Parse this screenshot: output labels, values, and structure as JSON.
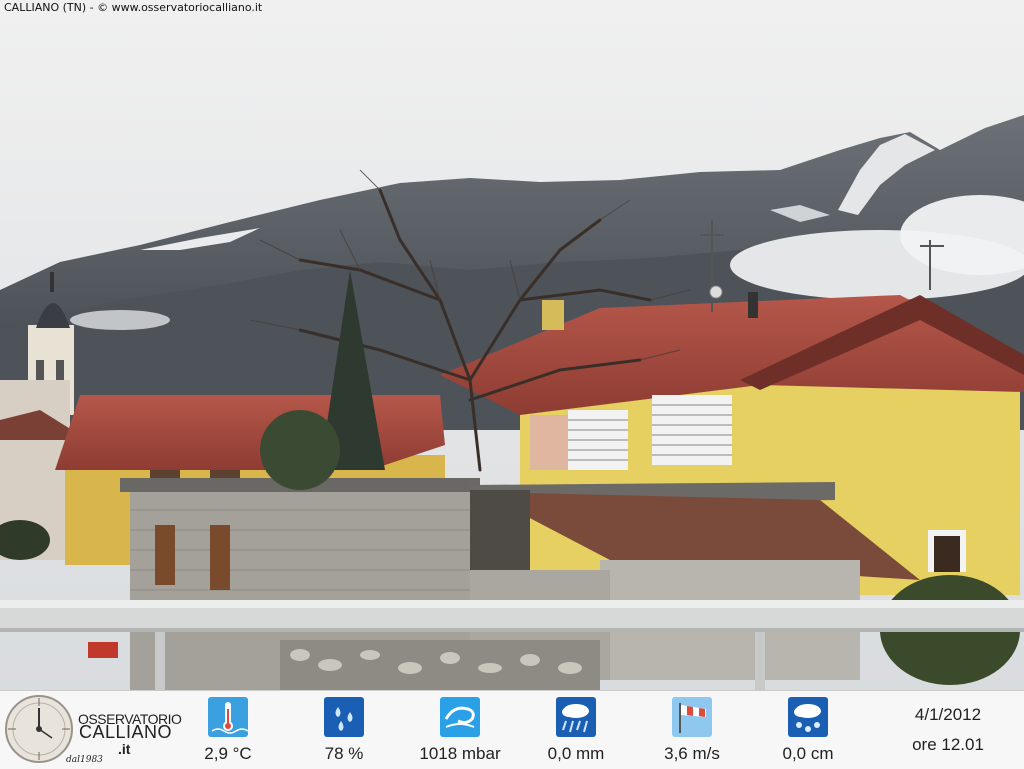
{
  "caption": "CALLIANO (TN) - © www.osservatoriocalliano.it",
  "logo": {
    "line1": "OSSERVATORIO",
    "line2": "CALLIANO",
    "line3": ".it",
    "line4": "dal1983"
  },
  "metrics": [
    {
      "icon": "thermometer-icon",
      "value": "2,9 °C",
      "color": "#3aa0e0"
    },
    {
      "icon": "humidity-drops-icon",
      "value": "78 %",
      "color": "#1a5fb4"
    },
    {
      "icon": "pressure-icon",
      "value": "1018 mbar",
      "color": "#2aa0e6"
    },
    {
      "icon": "rain-icon",
      "value": "0,0 mm",
      "color": "#1a5fb4"
    },
    {
      "icon": "windsock-icon",
      "value": "3,6 m/s",
      "color": "#8fc8ef"
    },
    {
      "icon": "snow-icon",
      "value": "0,0 cm",
      "color": "#1a5fb4"
    }
  ],
  "datetime": {
    "date": "4/1/2012",
    "time": "ore 12.01"
  }
}
